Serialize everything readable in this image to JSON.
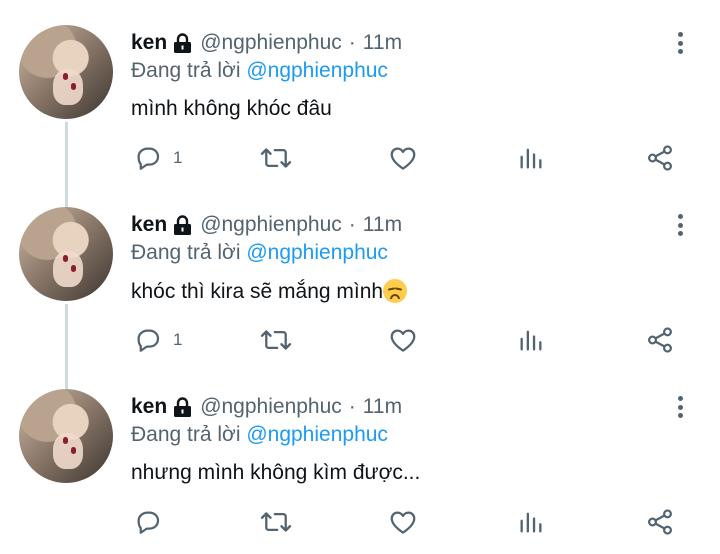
{
  "tweets": [
    {
      "name": "ken",
      "handle": "@ngphienphuc",
      "time": "11m",
      "replying_prefix": "Đang trả lời",
      "replying_to": "@ngphienphuc",
      "text": "mình không khóc đâu",
      "emoji": "",
      "reply_count": "1"
    },
    {
      "name": "ken",
      "handle": "@ngphienphuc",
      "time": "11m",
      "replying_prefix": "Đang trả lời",
      "replying_to": "@ngphienphuc",
      "text": "khóc thì kira sẽ mắng mình",
      "emoji": "disappointed-face-emoji",
      "reply_count": "1"
    },
    {
      "name": "ken",
      "handle": "@ngphienphuc",
      "time": "11m",
      "replying_prefix": "Đang trả lời",
      "replying_to": "@ngphienphuc",
      "text": "nhưng mình không kìm được...",
      "emoji": "",
      "reply_count": ""
    }
  ],
  "separator": "·",
  "icons": {
    "lock": "lock-icon",
    "more": "more-vertical-icon",
    "reply": "reply-icon",
    "retweet": "retweet-icon",
    "like": "heart-icon",
    "views": "analytics-icon",
    "share": "share-icon"
  },
  "colors": {
    "text": "#0f1419",
    "secondary": "#536471",
    "link": "#1d9bf0",
    "thread_line": "#cfd9de"
  }
}
